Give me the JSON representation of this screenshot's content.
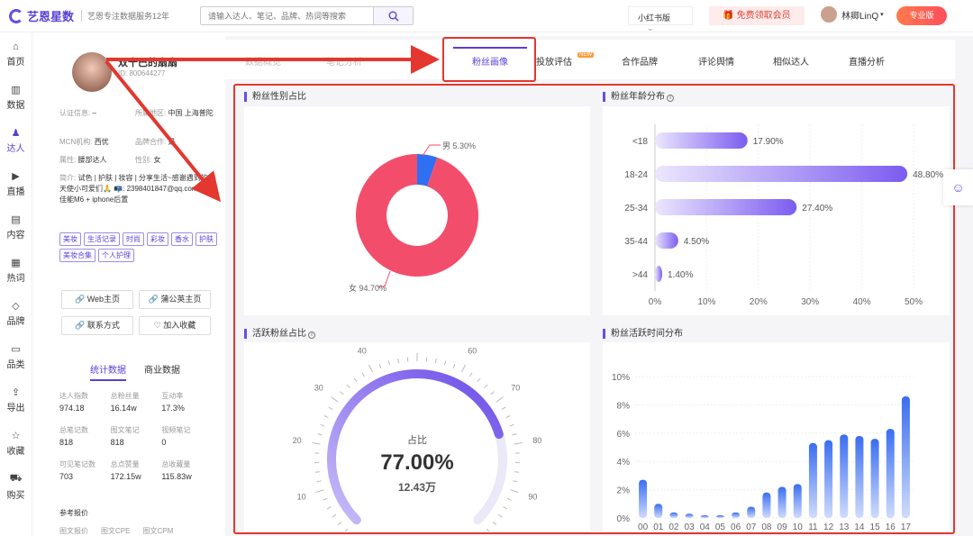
{
  "header": {
    "logo_text": "艺恩星数",
    "logo_sub": "艺恩专注数据服务12年",
    "search_placeholder": "请输入达人、笔记、品牌、热词等搜索",
    "platform": "小红书版",
    "member_button": "免费领取会员",
    "user_name": "林卿LinQ",
    "pro_button": "专业版"
  },
  "leftnav": {
    "items": [
      {
        "label": "首页",
        "icon": "home-icon"
      },
      {
        "label": "数据",
        "icon": "chart-icon"
      },
      {
        "label": "达人",
        "icon": "person-icon"
      },
      {
        "label": "直播",
        "icon": "play-icon"
      },
      {
        "label": "内容",
        "icon": "doc-icon"
      },
      {
        "label": "热词",
        "icon": "bars-icon"
      },
      {
        "label": "品牌",
        "icon": "diamond-icon"
      },
      {
        "label": "品类",
        "icon": "box-icon"
      },
      {
        "label": "导出",
        "icon": "export-icon"
      },
      {
        "label": "收藏",
        "icon": "star-icon"
      },
      {
        "label": "购买",
        "icon": "cart-icon"
      }
    ]
  },
  "profile": {
    "name": "双十巴的扇扇",
    "id": "ID: 800644277",
    "auth_label": "认证信息:",
    "auth_value": "–",
    "region_label": "所属地区:",
    "region_value": "中国 上海普陀",
    "mcn_label": "MCN机构:",
    "mcn_value": "西优",
    "brand_coop_label": "品牌合作:",
    "brand_coop_value": "是",
    "attr_label": "属性:",
    "attr_value": "腰部达人",
    "gender_label": "性别:",
    "gender_value": "女",
    "bio_label": "简介:",
    "bio_value": "试色 | 护肤 | 妆容 | 分享生活~感谢遇到的天使小可爱们🙏 📭: 2398401847@qq.com 📸: 佳能M6 + iphone后置",
    "tags": [
      "美妆",
      "生活记录",
      "时尚",
      "彩妆",
      "香水",
      "护肤",
      "美妆合集",
      "个人护理"
    ],
    "buttons": {
      "web": "Web主页",
      "pugongying": "蒲公英主页",
      "contact": "联系方式",
      "favorite": "加入收藏"
    },
    "stat_tabs": [
      "统计数据",
      "商业数据"
    ],
    "stats": [
      {
        "label": "达人指数",
        "value": "974.18"
      },
      {
        "label": "总粉丝量",
        "value": "16.14w"
      },
      {
        "label": "互动率",
        "value": "17.3%"
      },
      {
        "label": "总笔记数",
        "value": "818"
      },
      {
        "label": "图文笔记",
        "value": "818"
      },
      {
        "label": "视频笔记",
        "value": "0"
      },
      {
        "label": "可见笔记数",
        "value": "703"
      },
      {
        "label": "总点赞量",
        "value": "172.15w"
      },
      {
        "label": "总收藏量",
        "value": "115.83w"
      }
    ],
    "price_title": "参考报价",
    "price_items": [
      "图文报价",
      "图文CPE",
      "图文CPM"
    ]
  },
  "tabs": [
    "数据概览",
    "笔记分析",
    "笔记",
    "粉丝画像",
    "投放评估",
    "合作品牌",
    "评论舆情",
    "相似达人",
    "直播分析"
  ],
  "new_badge": "NEW",
  "gender_card": {
    "title": "粉丝性别占比",
    "label_male": "男 5.30%",
    "label_female": "女 94.70%"
  },
  "age_card": {
    "title": "粉丝年龄分布"
  },
  "active_card": {
    "title": "活跃粉丝占比",
    "center_label": "占比",
    "percent": "77.00%",
    "count": "12.43万"
  },
  "time_card": {
    "title": "粉丝活跃时间分布"
  },
  "colors": {
    "accent": "#5a3fd6",
    "female": "#f24e6c",
    "male": "#2f6ff2",
    "highlight": "#e3372f"
  },
  "chart_data": [
    {
      "type": "pie",
      "title": "粉丝性别占比",
      "labels": [
        "男",
        "女"
      ],
      "values": [
        5.3,
        94.7
      ]
    },
    {
      "type": "bar",
      "title": "粉丝年龄分布",
      "categories": [
        "<18",
        "18-24",
        "25-34",
        "35-44",
        ">44"
      ],
      "values": [
        17.9,
        48.8,
        27.4,
        4.5,
        1.4
      ],
      "value_labels": [
        "17.90%",
        "48.80%",
        "27.40%",
        "4.50%",
        "1.40%"
      ],
      "xlim": [
        0,
        50
      ],
      "xticks": [
        "0%",
        "10%",
        "20%",
        "30%",
        "40%",
        "50%"
      ],
      "orientation": "horizontal"
    },
    {
      "type": "gauge",
      "title": "活跃粉丝占比",
      "value": 77.0,
      "range": [
        0,
        100
      ],
      "ticks": [
        "0",
        "10",
        "20",
        "30",
        "40",
        "50",
        "60",
        "70",
        "80",
        "90",
        "100"
      ]
    },
    {
      "type": "bar",
      "title": "粉丝活跃时间分布",
      "categories": [
        "00",
        "01",
        "02",
        "03",
        "04",
        "05",
        "06",
        "07",
        "08",
        "09",
        "10",
        "11",
        "12",
        "13",
        "14",
        "15",
        "16",
        "17"
      ],
      "values": [
        2.7,
        1.0,
        0.4,
        0.3,
        0.2,
        0.2,
        0.4,
        0.8,
        1.8,
        2.2,
        2.4,
        5.3,
        5.5,
        5.9,
        5.8,
        5.6,
        6.3,
        8.6
      ],
      "ylim": [
        0,
        10
      ],
      "yticks": [
        "0%",
        "2%",
        "4%",
        "6%",
        "8%",
        "10%"
      ]
    }
  ]
}
